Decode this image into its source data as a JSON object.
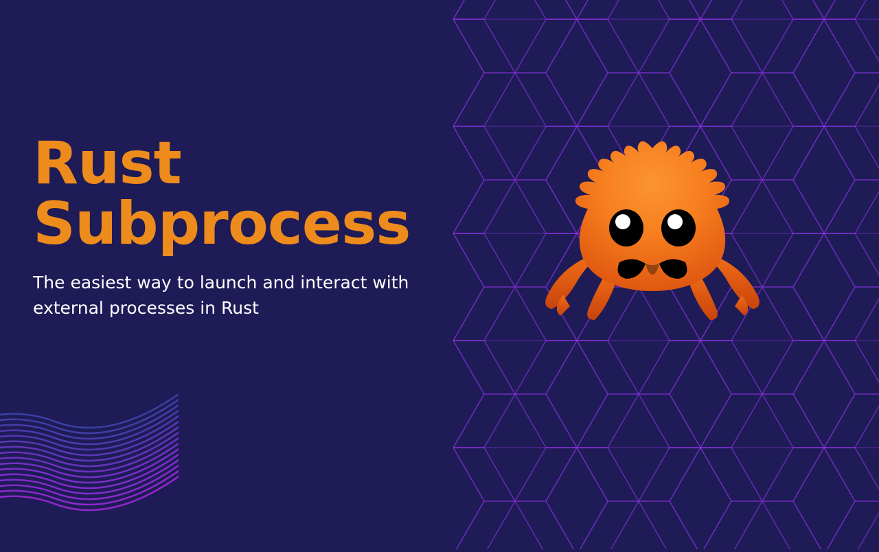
{
  "heading": {
    "line1": "Rust",
    "line2": "Subprocess"
  },
  "subtitle": "The easiest way to launch and interact with external processes in Rust",
  "colors": {
    "background": "#1e1b56",
    "accent": "#ed8b1c",
    "pattern": "#9333ea",
    "text": "#ffffff"
  },
  "mascot": "ferris-crab-icon"
}
